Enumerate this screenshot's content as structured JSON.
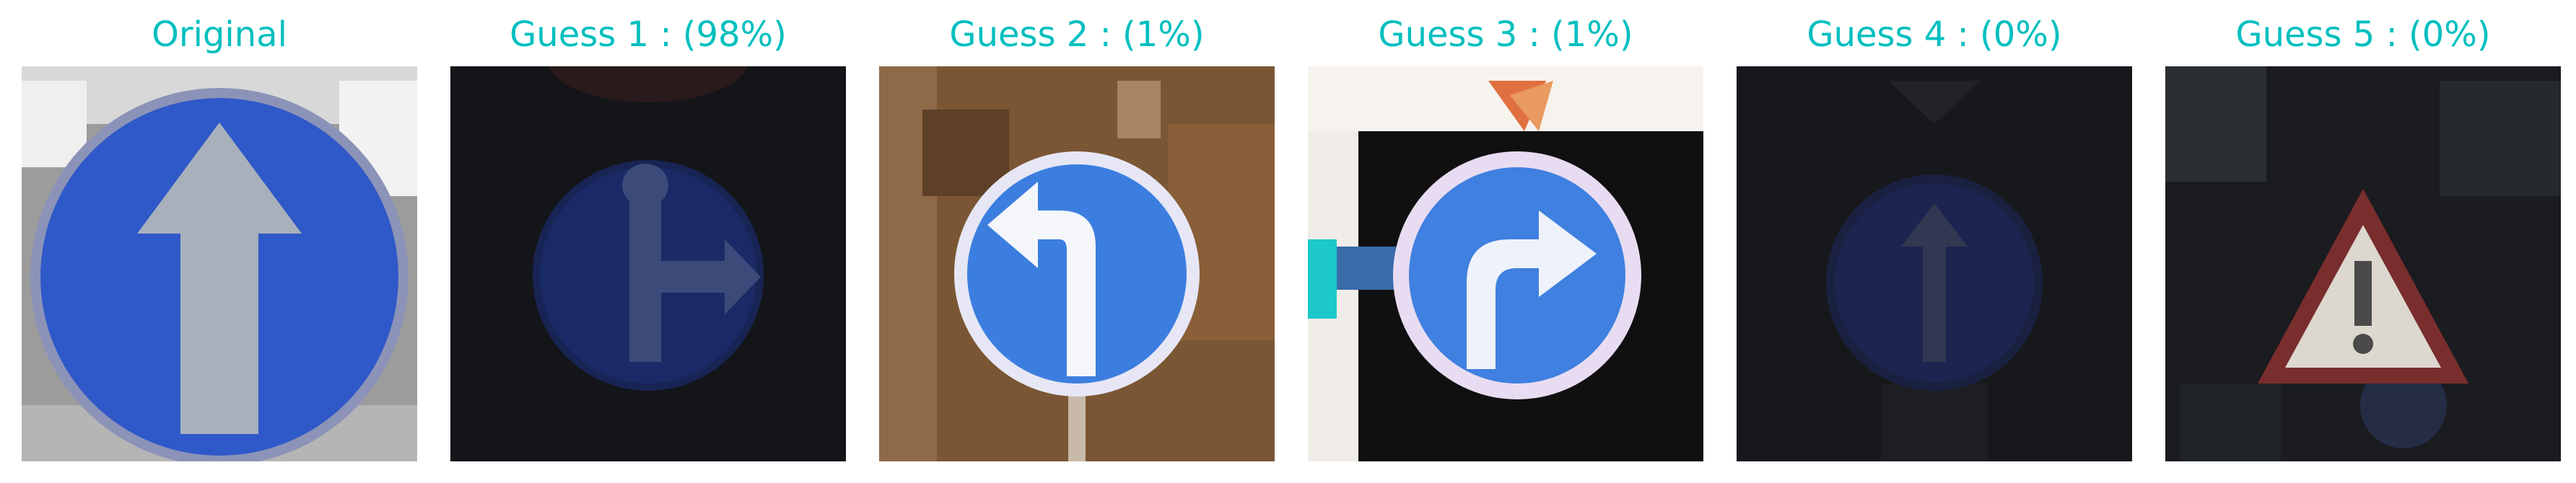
{
  "panels": [
    {
      "title": "Original",
      "image": "sign-ahead-only-original"
    },
    {
      "title": "Guess 1 : (98%)",
      "image": "sign-straight-or-right"
    },
    {
      "title": "Guess 2 : (1%)",
      "image": "sign-turn-left"
    },
    {
      "title": "Guess 3 : (1%)",
      "image": "sign-turn-right"
    },
    {
      "title": "Guess 4 : (0%)",
      "image": "sign-ahead-only-dark"
    },
    {
      "title": "Guess 5 : (0%)",
      "image": "sign-warning-triangle"
    }
  ],
  "colors": {
    "title_text": "#00bfbf",
    "sign_blue": "#2f59c8",
    "arrow_grey": "#a8b0bc"
  }
}
